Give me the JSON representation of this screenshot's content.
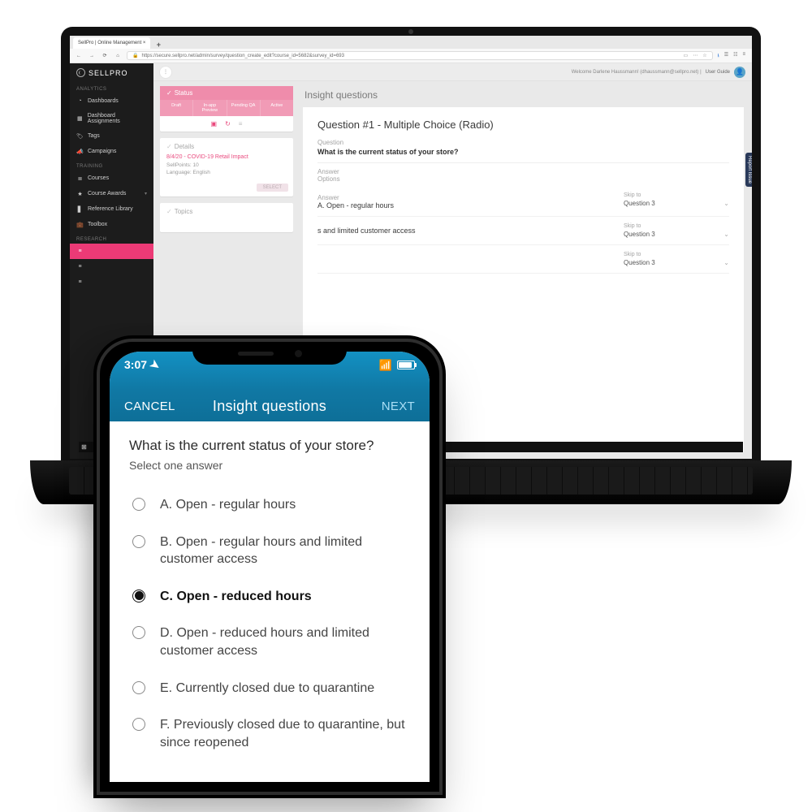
{
  "laptop": {
    "tab_title": "SellPro | Online Management ×",
    "url": "https://secure.sellpro.net/admin/survey/question_create_edit?course_id=5682&survey_id=693",
    "user_welcome": "Welcome Darlene Haussmann! (dhaussmann@sellpro.net) |",
    "user_guide": "User Guide",
    "brand": "SELLPRO",
    "side_sections": {
      "analytics": "ANALYTICS",
      "training": "TRAINING",
      "research": "RESEARCH"
    },
    "side_items": {
      "dashboards": "Dashboards",
      "dash_assign": "Dashboard Assignments",
      "tags": "Tags",
      "campaigns": "Campaigns",
      "courses": "Courses",
      "awards": "Course Awards",
      "reference": "Reference Library",
      "toolbox": "Toolbox"
    },
    "status": {
      "title": "Status",
      "tabs": [
        "Draft",
        "In-app Preview",
        "Pending QA",
        "Active"
      ]
    },
    "details": {
      "title": "Details",
      "line1": "8/4/20 - COVID-19 Retail Impact",
      "line2": "SellPoints: 10",
      "line3": "Language: English",
      "select_btn": "SELECT"
    },
    "topics": {
      "title": "Topics"
    },
    "page_title": "Insight questions",
    "question": {
      "heading": "Question #1 - Multiple Choice (Radio)",
      "label_question": "Question",
      "text": "What is the current status of your store?",
      "label_answer_options": "Answer\nOptions",
      "rows": [
        {
          "ans_label": "Answer",
          "answer": "A.  Open - regular hours",
          "skip_label": "Skip to",
          "skip_to": "Question 3"
        },
        {
          "ans_label": "",
          "answer": "s and limited customer access",
          "skip_label": "Skip to",
          "skip_to": "Question 3"
        },
        {
          "ans_label": "",
          "answer": "",
          "skip_label": "Skip to",
          "skip_to": "Question 3"
        }
      ]
    },
    "report_tab": "Report Issue"
  },
  "phone": {
    "time": "3:07",
    "cancel": "CANCEL",
    "title": "Insight questions",
    "next": "NEXT",
    "question": "What is the current status of your store?",
    "instruction": "Select one answer",
    "options": [
      "A.  Open - regular hours",
      "B.  Open - regular hours and limited customer access",
      "C.  Open - reduced hours",
      "D.  Open - reduced hours and limited customer access",
      "E.  Currently closed due to quarantine",
      "F.  Previously closed due to quarantine, but since reopened"
    ],
    "selected_index": 2
  }
}
